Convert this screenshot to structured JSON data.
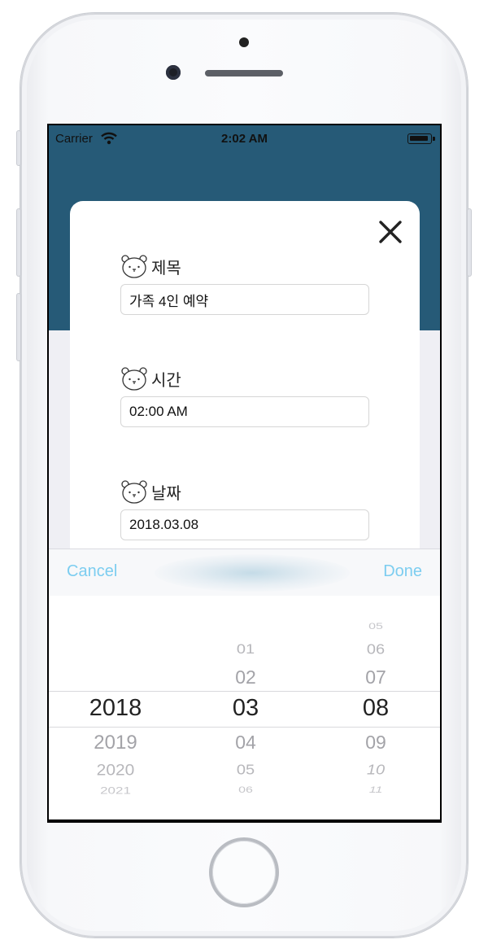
{
  "status_bar": {
    "carrier": "Carrier",
    "time": "2:02 AM"
  },
  "form": {
    "title_label": "제목",
    "title_value": "가족 4인 예약",
    "time_label": "시간",
    "time_value": "02:00 AM",
    "date_label": "날짜",
    "date_value": "2018.03.08"
  },
  "toolbar": {
    "cancel_label": "Cancel",
    "done_label": "Done"
  },
  "picker": {
    "year": {
      "selected": "2018",
      "below": [
        "2019",
        "2020",
        "2021"
      ]
    },
    "month": {
      "above": [
        "01",
        "02"
      ],
      "selected": "03",
      "below": [
        "04",
        "05",
        "06"
      ]
    },
    "day": {
      "above": [
        "05",
        "06",
        "07"
      ],
      "selected": "08",
      "below": [
        "09",
        "10",
        "11"
      ]
    }
  },
  "colors": {
    "navbar": "#265a77",
    "accent": "#7ccdf0"
  },
  "icons": {
    "close": "close-icon",
    "field_marker": "bear-face-icon",
    "wifi": "wifi-icon",
    "battery": "battery-icon"
  }
}
